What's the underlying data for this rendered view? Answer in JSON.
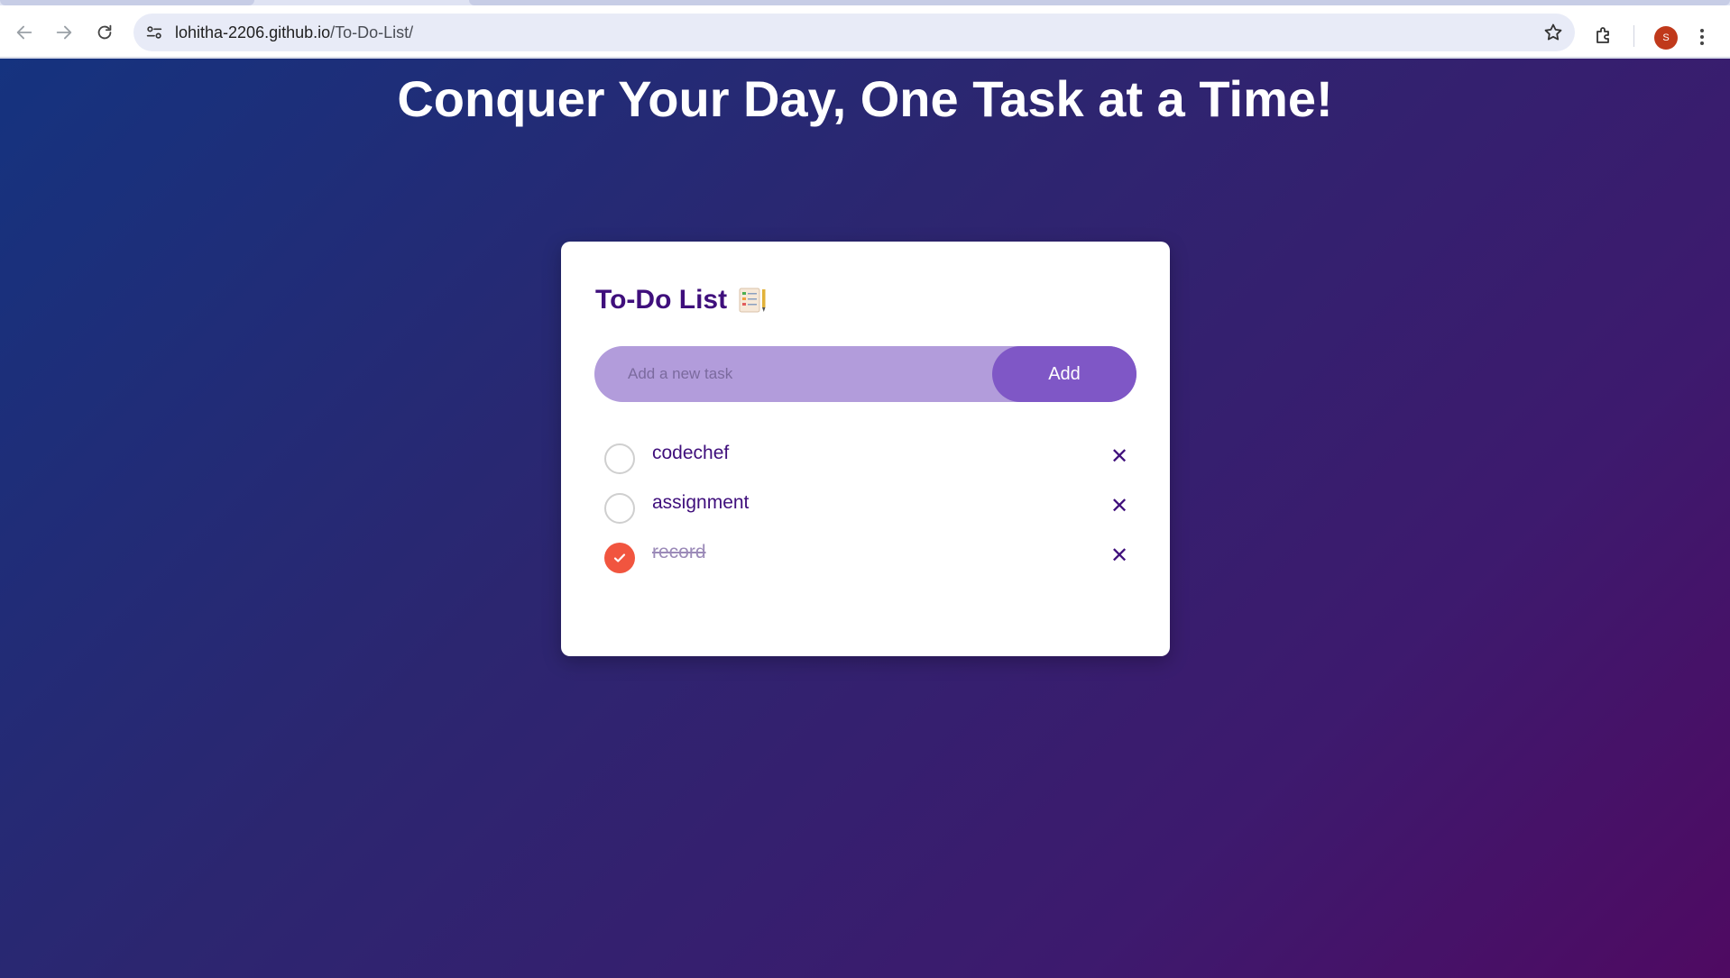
{
  "browser": {
    "url_host": "lohitha-2206.github.io",
    "url_path": "/To-Do-List/",
    "avatar_initial": "S",
    "icons": [
      "back-icon",
      "forward-icon",
      "reload-icon",
      "site-settings-icon",
      "bookmark-star-icon",
      "extensions-icon",
      "more-menu-icon"
    ]
  },
  "page": {
    "headline": "Conquer Your Day, One Task at a Time!",
    "colors": {
      "gradient_start": "#15337f",
      "gradient_end": "#4f0a62",
      "title": "#3f0f7c",
      "input_bg": "#b29cdb",
      "button": "#7f57c6",
      "done": "#f1553f"
    }
  },
  "card": {
    "title": "To-Do List",
    "title_icon": "memo-icon",
    "input_placeholder": "Add a new task",
    "input_value": "",
    "add_label": "Add",
    "delete_glyph": "✕",
    "tasks": [
      {
        "text": "codechef",
        "done": false
      },
      {
        "text": "assignment",
        "done": false
      },
      {
        "text": "record",
        "done": true
      }
    ]
  }
}
